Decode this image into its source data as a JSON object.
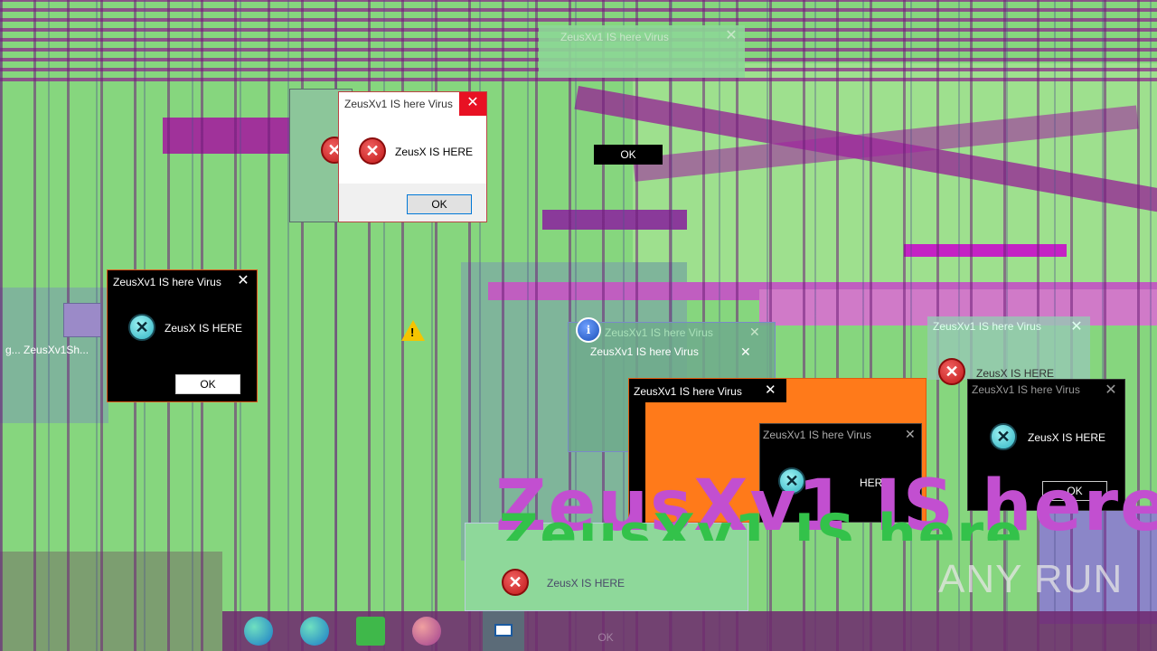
{
  "dialogs": {
    "main": {
      "title": "ZeusXv1 IS here Virus",
      "message": "ZeusX IS HERE",
      "ok": "OK",
      "close": "✕"
    },
    "left_dark": {
      "title": "ZeusXv1 IS here Virus",
      "message": "ZeusX IS HERE",
      "ok": "OK",
      "close": "✕"
    },
    "orange": {
      "title": "ZeusXv1 IS here Virus",
      "close": "✕"
    },
    "right_dark": {
      "title": "ZeusXv1 IS here Virus",
      "message": "ZeusX IS HERE",
      "ok": "OK",
      "close": "✕"
    },
    "center_dark": {
      "title": "ZeusXv1 IS here Virus",
      "message": "HERE",
      "close": "✕"
    },
    "top_ghost": {
      "title": "ZeusXv1 IS here Virus",
      "close": "✕"
    },
    "info_ghost": {
      "title": "ZeusXv1 IS here Virus",
      "subtitle": "ZeusXv1 IS here Virus",
      "close": "✕"
    },
    "right_ghost": {
      "title": "ZeusXv1 IS here Virus",
      "message": "ZeusX IS HERE",
      "close": "✕"
    },
    "bottom_ghost": {
      "message": "ZeusX IS HERE",
      "ok": "OK"
    },
    "stray_ok": {
      "ok": "OK"
    }
  },
  "banner": {
    "text": "ZeusXv1 IS here"
  },
  "desktop": {
    "shortcut_label": "g... ZeusXv1Sh..."
  },
  "watermark": {
    "text": "ANY RUN"
  },
  "icons": {
    "error": "error-icon",
    "cyan_error": "cyan-error-icon",
    "warning": "warning-icon",
    "info": "info-icon",
    "edge": "edge-icon",
    "explorer": "folder-icon"
  },
  "colors": {
    "accent_orange": "#ff7a1a",
    "magenta": "#b03ab0",
    "close_red": "#e81123"
  }
}
